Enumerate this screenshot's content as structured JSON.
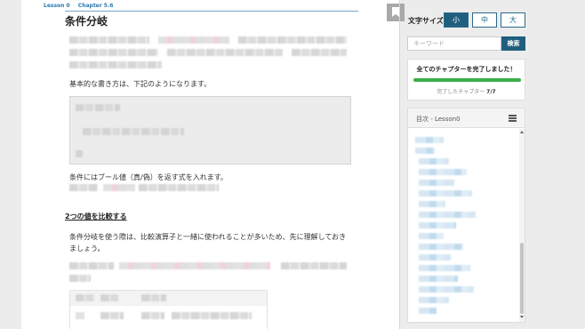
{
  "breadcrumb": {
    "lesson": "Lesson 0",
    "chapter": "Chapter 5.6"
  },
  "page_title": "条件分岐",
  "paragraphs": {
    "intro_syntax": "基本的な書き方は、下記のようになります。",
    "condition_note": "条件にはブール値（真/偽）を返す式を入れます。",
    "compare_line1": "条件分岐を使う際は、比較演算子と一緒に使われることが多いため、先に理解しておき",
    "compare_line2": "ましょう。"
  },
  "section_heading": "2つの値を比較する",
  "sidebar": {
    "font_size_label": "文字サイズ",
    "font_sizes": [
      "小",
      "中",
      "大"
    ],
    "active_font_size": "小",
    "search_placeholder": "キーワード",
    "search_button": "検索",
    "progress": {
      "title": "全てのチャプターを完了しました！",
      "count_label": "完了したチャプター",
      "count_value": "7/7",
      "fraction": 1.0
    },
    "toc_title": "目次 - Lesson0"
  },
  "colors": {
    "accent": "#1f5f7e",
    "link": "#2a7ab0",
    "progress": "#3cae4a"
  },
  "icons": {
    "bookmark": "bookmark-icon",
    "toc_list": "list-icon"
  }
}
